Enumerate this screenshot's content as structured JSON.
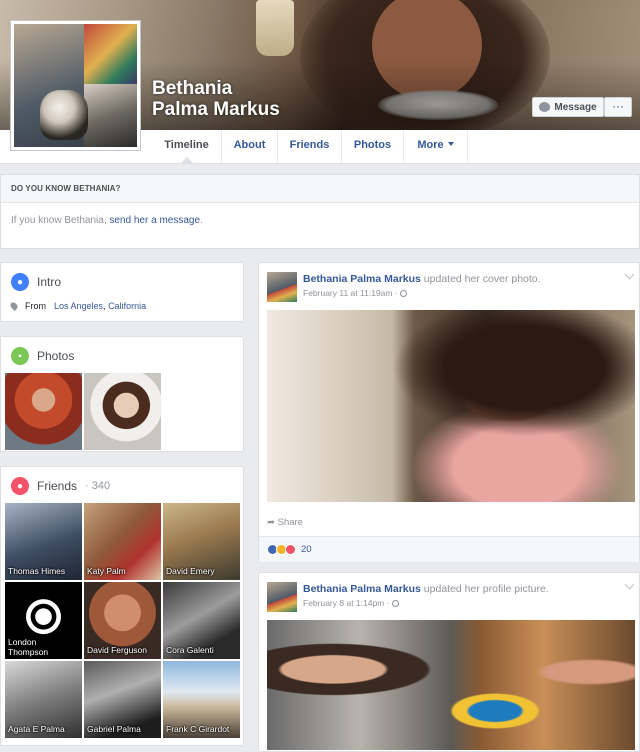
{
  "profile": {
    "name": "Bethania Palma Markus"
  },
  "actions": {
    "message": "Message",
    "more": "···"
  },
  "tabs": [
    {
      "label": "Timeline"
    },
    {
      "label": "About"
    },
    {
      "label": "Friends"
    },
    {
      "label": "Photos"
    },
    {
      "label": "More"
    }
  ],
  "know_card": {
    "heading": "DO YOU KNOW BETHANIA?",
    "text_prefix": "If you know Bethania, ",
    "link": "send her a message",
    "text_suffix": "."
  },
  "intro": {
    "title": "Intro",
    "from_label": "From",
    "city": "Los Angeles",
    "separator": ", ",
    "state": "California"
  },
  "photos": {
    "title": "Photos"
  },
  "friends": {
    "title": "Friends",
    "count": "· 340",
    "list": [
      {
        "name": "Thomas Himes"
      },
      {
        "name": "Katy Palm"
      },
      {
        "name": "David Emery"
      },
      {
        "name": "London Thompson"
      },
      {
        "name": "David Ferguson"
      },
      {
        "name": "Cora Galenti"
      },
      {
        "name": "Agata E Palma"
      },
      {
        "name": "Gabriel Palma"
      },
      {
        "name": "Frank C Girardot"
      }
    ]
  },
  "posts": [
    {
      "author": "Bethania Palma Markus",
      "action": " updated her cover photo.",
      "time": "February 11 at 11:19am · ",
      "share": "Share",
      "reaction_count": "20"
    },
    {
      "author": "Bethania Palma Markus",
      "action": " updated her profile picture.",
      "time": "February 8 at 1:14pm · "
    }
  ],
  "colors": {
    "link": "#365899",
    "background": "#e9ebee",
    "intro_icon": "#4080ff",
    "photos_icon": "#7bc654",
    "friends_icon": "#f35369"
  }
}
